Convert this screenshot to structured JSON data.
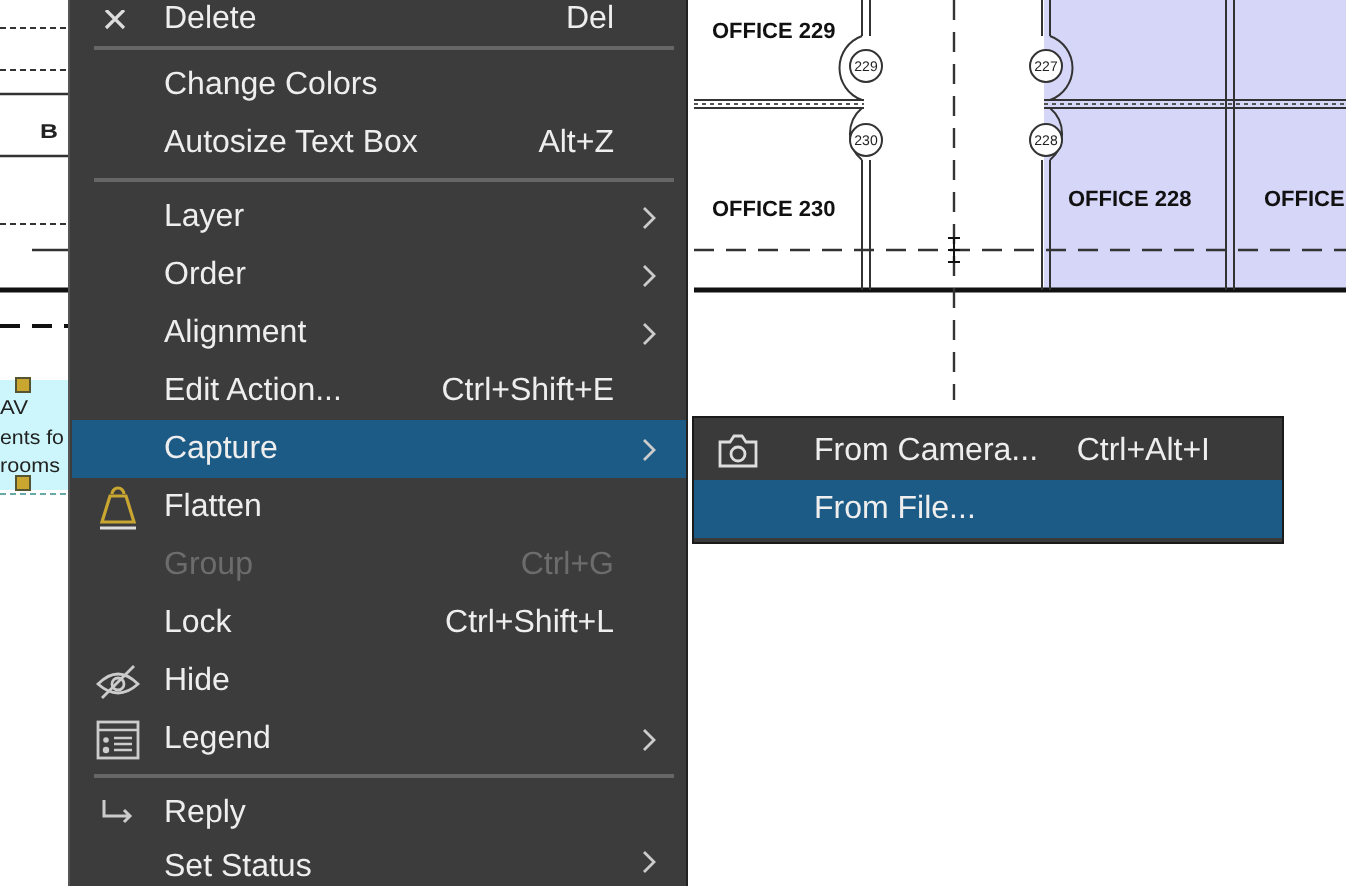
{
  "floor_plan": {
    "fragments": [
      {
        "text": "B"
      },
      {
        "text": "AV"
      },
      {
        "text": "ents fo"
      },
      {
        "text": "rooms"
      }
    ],
    "room_labels": [
      {
        "text": "OFFICE 229"
      },
      {
        "text": "OFFICE 230"
      },
      {
        "text": "OFFICE 228"
      },
      {
        "text": "OFFICE"
      }
    ],
    "door_tags": [
      {
        "text": "229"
      },
      {
        "text": "230"
      },
      {
        "text": "227"
      },
      {
        "text": "228"
      }
    ]
  },
  "context_menu": {
    "items": [
      {
        "kind": "item",
        "label": "Delete",
        "shortcut": "Del",
        "submenu": false,
        "disabled": false,
        "selected": false
      },
      {
        "kind": "separator"
      },
      {
        "kind": "item",
        "label": "Change Colors",
        "submenu": false,
        "disabled": false,
        "selected": false
      },
      {
        "kind": "item",
        "label": "Autosize Text Box",
        "shortcut": "Alt+Z",
        "submenu": false,
        "disabled": false,
        "selected": false
      },
      {
        "kind": "separator"
      },
      {
        "kind": "item",
        "label": "Layer",
        "submenu": true,
        "disabled": false,
        "selected": false
      },
      {
        "kind": "item",
        "label": "Order",
        "submenu": true,
        "disabled": false,
        "selected": false
      },
      {
        "kind": "item",
        "label": "Alignment",
        "submenu": true,
        "disabled": false,
        "selected": false
      },
      {
        "kind": "item",
        "label": "Edit Action...",
        "shortcut": "Ctrl+Shift+E",
        "submenu": false,
        "disabled": false,
        "selected": false
      },
      {
        "kind": "item",
        "label": "Capture",
        "submenu": true,
        "disabled": false,
        "selected": true
      },
      {
        "kind": "item",
        "label": "Flatten",
        "submenu": false,
        "disabled": false,
        "selected": false
      },
      {
        "kind": "item",
        "label": "Group",
        "shortcut": "Ctrl+G",
        "submenu": false,
        "disabled": true,
        "selected": false
      },
      {
        "kind": "item",
        "label": "Lock",
        "shortcut": "Ctrl+Shift+L",
        "submenu": false,
        "disabled": false,
        "selected": false
      },
      {
        "kind": "item",
        "label": "Hide",
        "submenu": false,
        "disabled": false,
        "selected": false
      },
      {
        "kind": "item",
        "label": "Legend",
        "submenu": true,
        "disabled": false,
        "selected": false
      },
      {
        "kind": "separator"
      },
      {
        "kind": "item",
        "label": "Reply",
        "submenu": false,
        "disabled": false,
        "selected": false
      },
      {
        "kind": "item",
        "label": "Set Status",
        "submenu": true,
        "disabled": false,
        "selected": false
      }
    ]
  },
  "submenu": {
    "items": [
      {
        "label": "From Camera...",
        "shortcut": "Ctrl+Alt+I",
        "selected": false
      },
      {
        "label": "From File...",
        "selected": true
      }
    ]
  }
}
